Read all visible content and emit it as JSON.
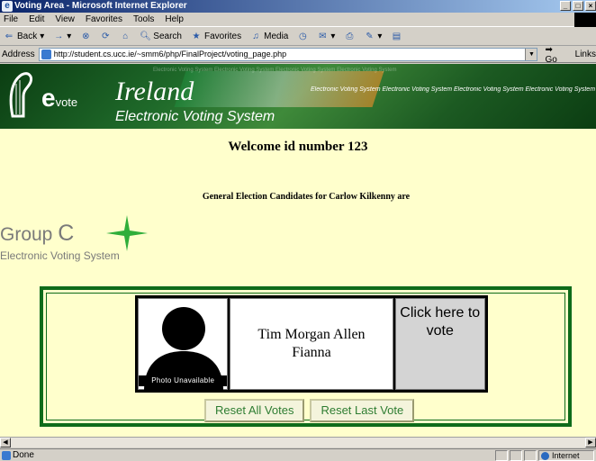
{
  "window": {
    "title": "Voting Area - Microsoft Internet Explorer",
    "controls": [
      "_",
      "□",
      "×"
    ]
  },
  "menu": [
    "File",
    "Edit",
    "View",
    "Favorites",
    "Tools",
    "Help"
  ],
  "toolbar": {
    "back": "Back",
    "forward": "→",
    "stop": "⊗",
    "refresh": "⟳",
    "home": "⌂",
    "search": "Search",
    "favorites": "Favorites",
    "media": "Media"
  },
  "address": {
    "label": "Address",
    "url": "http://student.cs.ucc.ie/~smm6/php/FinalProject/voting_page.php",
    "go": "Go",
    "links": "Links"
  },
  "banner": {
    "evote_e": "e",
    "evote_rest": "vote",
    "ireland": "Ireland",
    "subtitle": "Electronic Voting System",
    "scroller": "Electronic Voting System Electronic Voting System Electronic Voting System Electronic Voting System"
  },
  "page": {
    "welcome": "Welcome id number 123",
    "candidates_title": "General Election Candidates for Carlow Kilkenny are",
    "group_prefix": "Group",
    "group_letter": "C",
    "group_subtitle": "Electronic Voting System"
  },
  "candidate": {
    "name": "Tim Morgan Allen",
    "party": "Fianna",
    "photo_label": "Photo Unavailable",
    "vote_label": "Click here to vote"
  },
  "buttons": {
    "reset_all": "Reset All Votes",
    "reset_last": "Reset Last Vote"
  },
  "status": {
    "text": "Done",
    "zone": "Internet"
  },
  "colors": {
    "page_bg": "#ffffcc",
    "panel_border": "#0e6b1a",
    "button_text": "#2e7d32",
    "banner_green": "#1f6a2a"
  }
}
